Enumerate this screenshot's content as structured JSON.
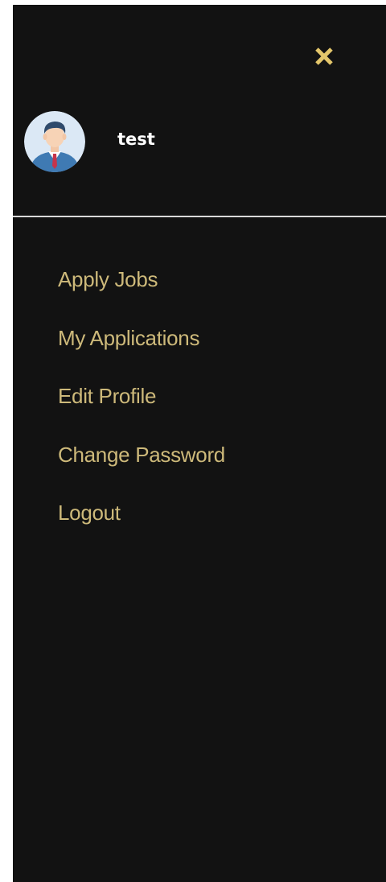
{
  "colors": {
    "background": "#121212",
    "accent": "#cdb97a",
    "close_icon": "#e3c66b",
    "username": "#ffffff",
    "divider": "#d9d9d9"
  },
  "header": {
    "close_icon": "close-icon"
  },
  "user": {
    "name": "test",
    "avatar_icon": "businessman-avatar-icon"
  },
  "menu": {
    "items": [
      {
        "label": "Apply Jobs"
      },
      {
        "label": "My Applications"
      },
      {
        "label": "Edit Profile"
      },
      {
        "label": "Change Password"
      },
      {
        "label": "Logout"
      }
    ]
  }
}
